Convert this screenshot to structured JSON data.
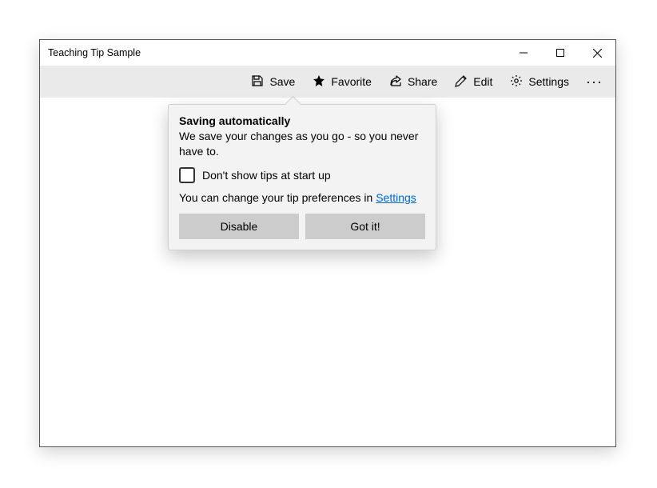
{
  "window": {
    "title": "Teaching Tip Sample"
  },
  "toolbar": {
    "save_label": "Save",
    "favorite_label": "Favorite",
    "share_label": "Share",
    "edit_label": "Edit",
    "settings_label": "Settings"
  },
  "tip": {
    "title": "Saving automatically",
    "body": "We save your changes as you go - so you never have to.",
    "checkbox_label": "Don't show tips at start up",
    "footer_text": "You can change your tip preferences in ",
    "footer_link": "Settings",
    "disable_label": "Disable",
    "gotit_label": "Got it!"
  }
}
